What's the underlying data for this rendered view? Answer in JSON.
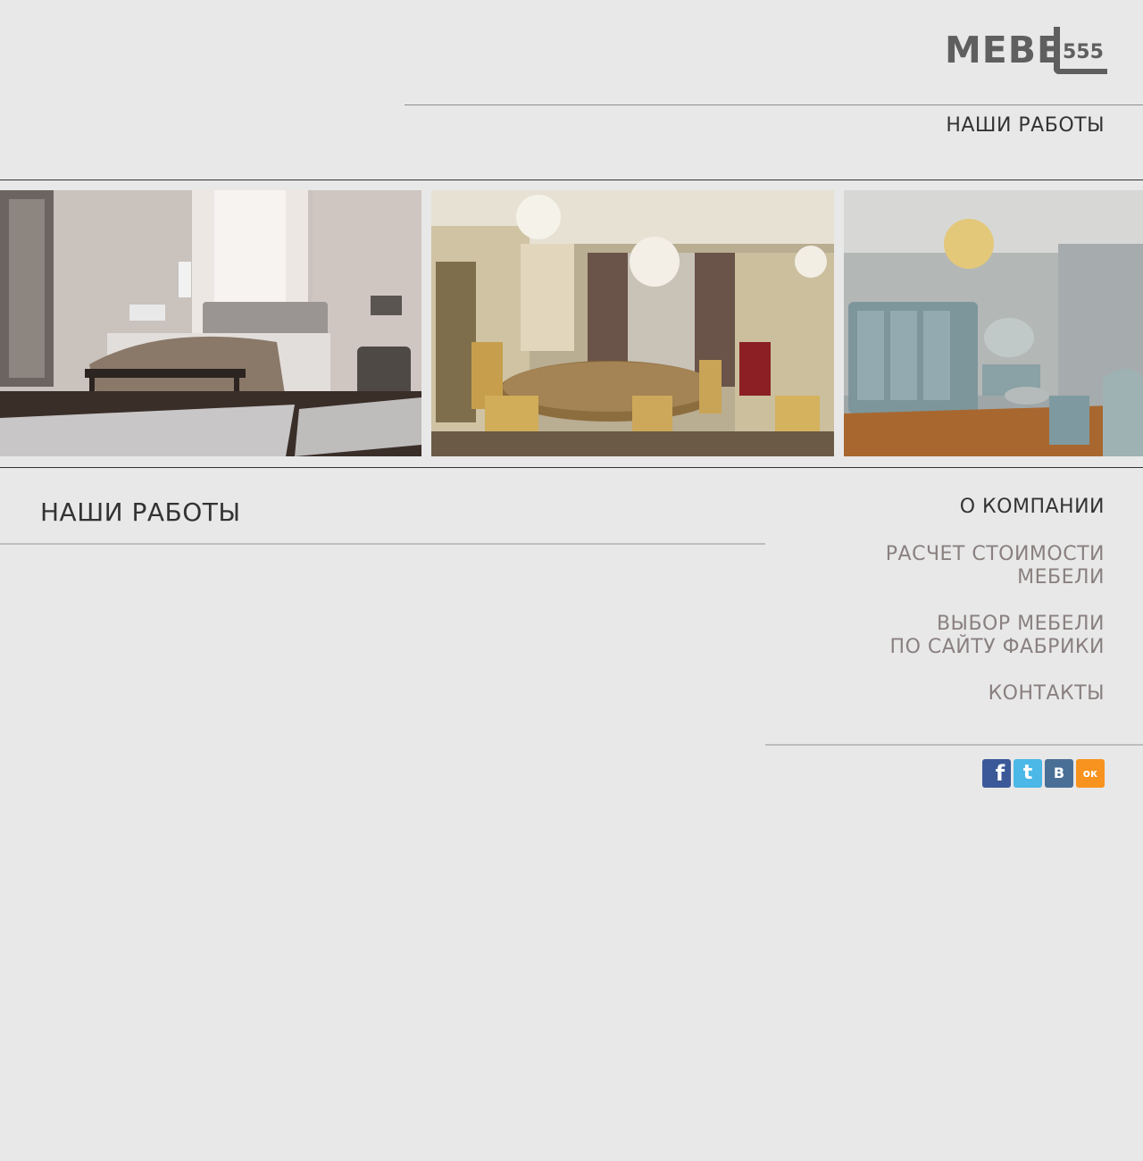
{
  "brand": {
    "logo_main": "MEBE",
    "logo_number": "555",
    "logo_color": "#5f5f5f"
  },
  "header": {
    "title": "НАШИ РАБОТЫ"
  },
  "gallery": [
    {
      "name": "bedroom-photo"
    },
    {
      "name": "dining-room-photo"
    },
    {
      "name": "classic-bedroom-photo"
    }
  ],
  "main": {
    "section_title": "НАШИ РАБОТЫ"
  },
  "nav": {
    "items": [
      {
        "line1": "О КОМПАНИИ",
        "line2": ""
      },
      {
        "line1": "РАСЧЕТ СТОИМОСТИ",
        "line2": "МЕБЕЛИ"
      },
      {
        "line1": "ВЫБОР МЕБЕЛИ",
        "line2": "ПО САЙТУ ФАБРИКИ"
      },
      {
        "line1": "КОНТАКТЫ",
        "line2": ""
      }
    ],
    "active_color": "#333333",
    "inactive_color": "#8a8080"
  },
  "social": {
    "facebook": {
      "glyph": "f",
      "color": "#3b5998"
    },
    "twitter": {
      "glyph": "t",
      "color": "#4bb8e8"
    },
    "vk": {
      "glyph": "B",
      "color": "#4a6f96"
    },
    "odnoklassniki": {
      "glyph": "ок",
      "color": "#f7931e"
    }
  },
  "colors": {
    "background": "#e8e8e8",
    "text_dark": "#333333",
    "rule": "#bdbdbd"
  }
}
